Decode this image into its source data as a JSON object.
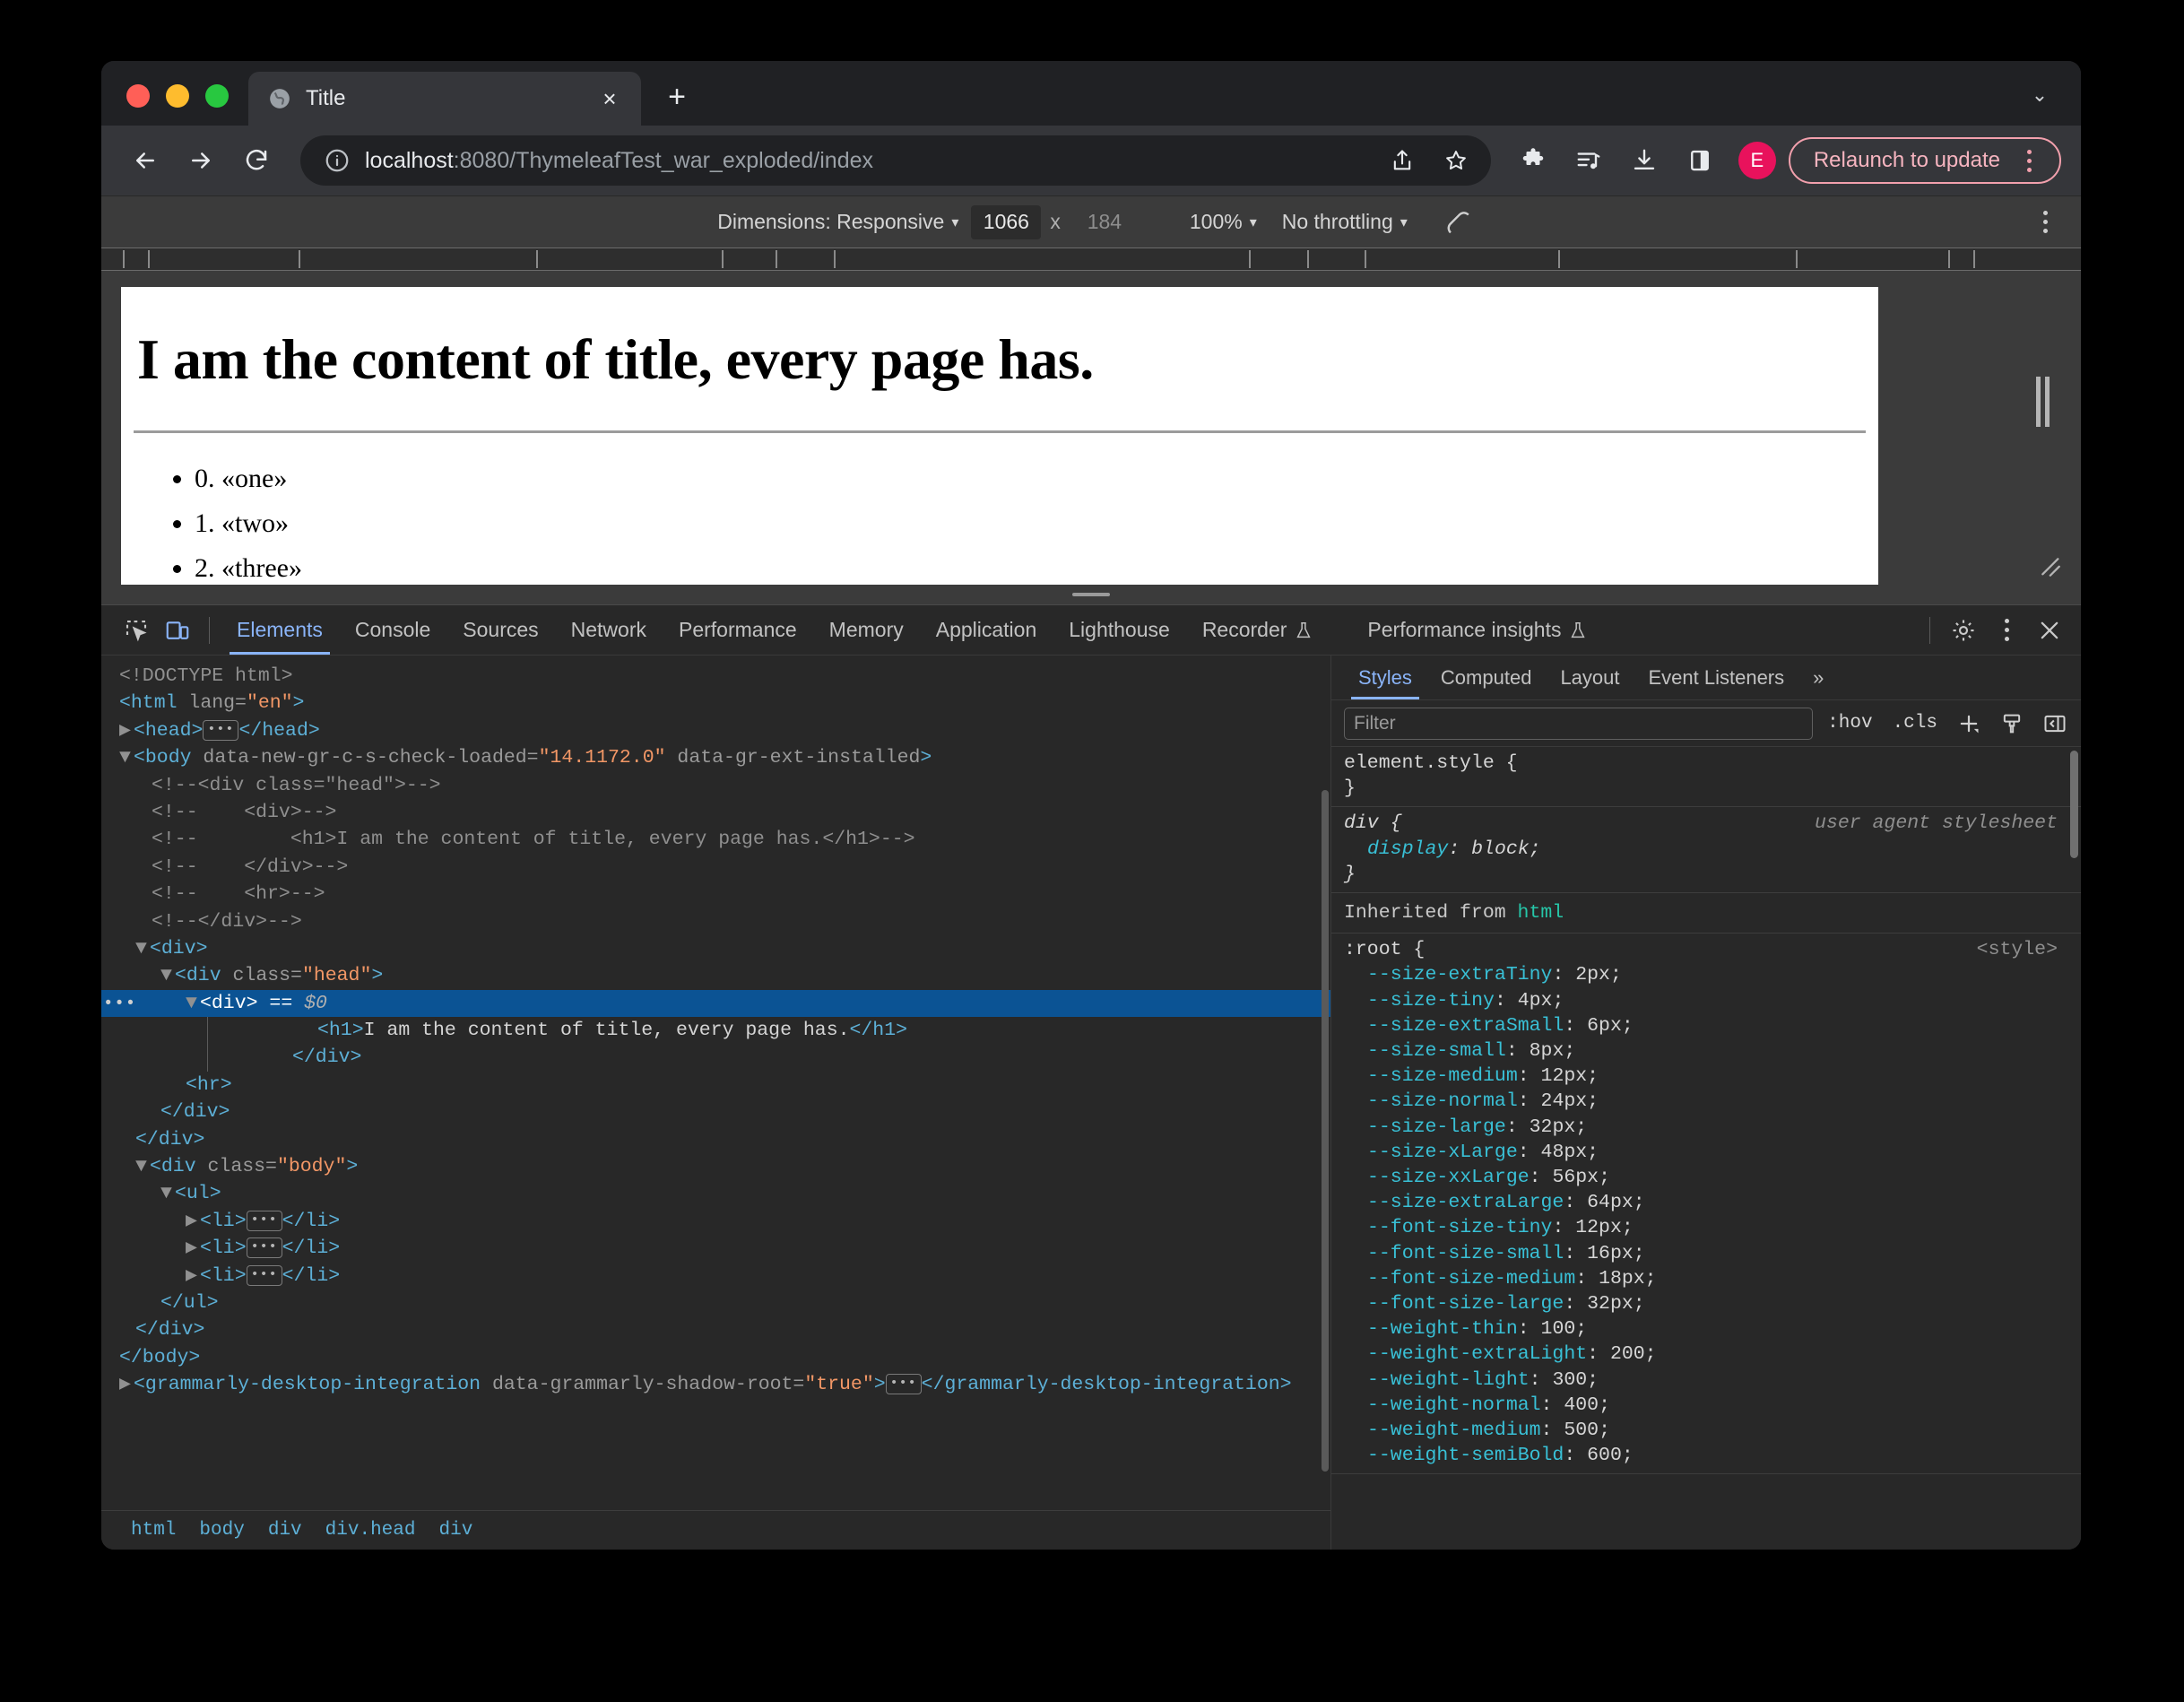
{
  "browser": {
    "tab": {
      "title": "Title",
      "favicon": "globe-icon",
      "close": "×"
    },
    "newtab_label": "+",
    "tabstrip_chevron": "⌄",
    "omnibox": {
      "host": "localhost",
      "path": ":8080/ThymeleafTest_war_exploded/index",
      "info_icon": "info-circle-icon"
    },
    "actions": {
      "back": "back-arrow-icon",
      "forward": "forward-arrow-icon",
      "reload": "reload-icon",
      "share": "share-icon",
      "bookmark": "star-icon",
      "extensions": "puzzle-piece-icon",
      "media": "media-list-icon",
      "downloads": "download-icon",
      "sidepanel": "side-panel-icon",
      "profile_initial": "E",
      "relaunch_label": "Relaunch to update",
      "relaunch_menu": "kebab-menu-icon",
      "relaunch_color": "#f2a0ad"
    }
  },
  "device_toolbar": {
    "dimensions_label": "Dimensions: Responsive",
    "width": "1066",
    "times": "x",
    "height": "184",
    "zoom": "100%",
    "throttling": "No throttling",
    "rotate_icon": "rotate-icon",
    "more_icon": "kebab-menu-icon"
  },
  "page": {
    "heading": "I am the content of title, every page has.",
    "list": [
      "0. «one»",
      "1. «two»",
      "2. «three»"
    ]
  },
  "devtools": {
    "inspect_icon": "inspect-element-icon",
    "device_icon": "device-toolbar-icon",
    "tabs": [
      {
        "label": "Elements",
        "active": true
      },
      {
        "label": "Console",
        "active": false
      },
      {
        "label": "Sources",
        "active": false
      },
      {
        "label": "Network",
        "active": false
      },
      {
        "label": "Performance",
        "active": false
      },
      {
        "label": "Memory",
        "active": false
      },
      {
        "label": "Application",
        "active": false
      },
      {
        "label": "Lighthouse",
        "active": false
      },
      {
        "label": "Recorder",
        "active": false,
        "badge": "experiment-flask-icon"
      },
      {
        "label": "Performance insights",
        "active": false,
        "badge": "experiment-flask-icon"
      }
    ],
    "settings_icon": "gear-icon",
    "more_icon": "kebab-menu-icon",
    "close_icon": "close-icon",
    "dom": {
      "lines": [
        {
          "indent": 0,
          "type": "doctype",
          "text": "<!DOCTYPE html>"
        },
        {
          "indent": 0,
          "type": "open",
          "tag": "html",
          "attrs": [
            {
              "name": "lang",
              "value": "en"
            }
          ]
        },
        {
          "indent": 0,
          "type": "collapsed",
          "twisty": "right",
          "tag": "head"
        },
        {
          "indent": 0,
          "type": "open",
          "twisty": "down",
          "tag": "body",
          "attrs": [
            {
              "name": "data-new-gr-c-s-check-loaded",
              "value": "14.1172.0"
            },
            {
              "name": "data-gr-ext-installed",
              "value": null
            }
          ]
        },
        {
          "indent": 1,
          "type": "comment",
          "text": "<!--<div class=\"head\">-->"
        },
        {
          "indent": 1,
          "type": "comment",
          "text": "<!--    <div>-->"
        },
        {
          "indent": 1,
          "type": "comment",
          "text": "<!--        <h1>I am the content of title, every page has.</h1>-->"
        },
        {
          "indent": 1,
          "type": "comment",
          "text": "<!--    </div>-->"
        },
        {
          "indent": 1,
          "type": "comment",
          "text": "<!--    <hr>-->"
        },
        {
          "indent": 1,
          "type": "comment",
          "text": "<!--</div>-->"
        },
        {
          "indent": 1,
          "type": "open",
          "twisty": "down",
          "tag": "div"
        },
        {
          "indent": 2,
          "type": "open",
          "twisty": "down",
          "tag": "div",
          "attrs": [
            {
              "name": "class",
              "value": "head"
            }
          ]
        },
        {
          "indent": 3,
          "type": "selected",
          "twisty": "down",
          "tag": "div",
          "suffix": "== $0"
        },
        {
          "indent": 4,
          "type": "text-node",
          "tag": "h1",
          "text": "I am the content of title, every page has."
        },
        {
          "indent": 3,
          "type": "close",
          "tag": "div"
        },
        {
          "indent": 3,
          "type": "void",
          "tag": "hr"
        },
        {
          "indent": 2,
          "type": "close",
          "tag": "div"
        },
        {
          "indent": 1,
          "type": "close",
          "tag": "div"
        },
        {
          "indent": 1,
          "type": "open",
          "twisty": "down",
          "tag": "div",
          "attrs": [
            {
              "name": "class",
              "value": "body"
            }
          ]
        },
        {
          "indent": 2,
          "type": "open",
          "twisty": "down",
          "tag": "ul"
        },
        {
          "indent": 3,
          "type": "collapsed",
          "twisty": "right",
          "tag": "li"
        },
        {
          "indent": 3,
          "type": "collapsed",
          "twisty": "right",
          "tag": "li"
        },
        {
          "indent": 3,
          "type": "collapsed",
          "twisty": "right",
          "tag": "li"
        },
        {
          "indent": 2,
          "type": "close",
          "tag": "ul"
        },
        {
          "indent": 1,
          "type": "close",
          "tag": "div"
        },
        {
          "indent": 0,
          "type": "close",
          "tag": "body"
        },
        {
          "indent": 0,
          "type": "collapsed",
          "twisty": "right",
          "tag": "grammarly-desktop-integration",
          "attrs": [
            {
              "name": "data-grammarly-shadow-root",
              "value": "true"
            }
          ]
        }
      ]
    },
    "breadcrumb": [
      "html",
      "body",
      "div",
      "div.head",
      "div"
    ],
    "styles": {
      "tabs": [
        {
          "label": "Styles",
          "active": true
        },
        {
          "label": "Computed",
          "active": false
        },
        {
          "label": "Layout",
          "active": false
        },
        {
          "label": "Event Listeners",
          "active": false
        },
        {
          "label": "»",
          "active": false
        }
      ],
      "filter_placeholder": "Filter",
      "hov_label": ":hov",
      "cls_label": ".cls",
      "add_rule_icon": "plus-icon",
      "class_icon": "paintbrush-icon",
      "sidebar_toggle_icon": "toggle-sidebar-icon",
      "rules": [
        {
          "selector": "element.style",
          "origin": "",
          "declarations": []
        },
        {
          "selector": "div",
          "origin": "user agent stylesheet",
          "italic": true,
          "declarations": [
            {
              "prop": "display",
              "value": "block"
            }
          ]
        }
      ],
      "inherited_label": "Inherited from",
      "inherited_element": "html",
      "root_rule": {
        "selector": ":root",
        "origin": "<style>",
        "declarations": [
          {
            "prop": "--size-extraTiny",
            "value": "2px"
          },
          {
            "prop": "--size-tiny",
            "value": "4px"
          },
          {
            "prop": "--size-extraSmall",
            "value": "6px"
          },
          {
            "prop": "--size-small",
            "value": "8px"
          },
          {
            "prop": "--size-medium",
            "value": "12px"
          },
          {
            "prop": "--size-normal",
            "value": "24px"
          },
          {
            "prop": "--size-large",
            "value": "32px"
          },
          {
            "prop": "--size-xLarge",
            "value": "48px"
          },
          {
            "prop": "--size-xxLarge",
            "value": "56px"
          },
          {
            "prop": "--size-extraLarge",
            "value": "64px"
          },
          {
            "prop": "--font-size-tiny",
            "value": "12px"
          },
          {
            "prop": "--font-size-small",
            "value": "16px"
          },
          {
            "prop": "--font-size-medium",
            "value": "18px"
          },
          {
            "prop": "--font-size-large",
            "value": "32px"
          },
          {
            "prop": "--weight-thin",
            "value": "100"
          },
          {
            "prop": "--weight-extraLight",
            "value": "200"
          },
          {
            "prop": "--weight-light",
            "value": "300"
          },
          {
            "prop": "--weight-normal",
            "value": "400"
          },
          {
            "prop": "--weight-medium",
            "value": "500"
          },
          {
            "prop": "--weight-semiBold",
            "value": "600"
          }
        ]
      }
    }
  }
}
